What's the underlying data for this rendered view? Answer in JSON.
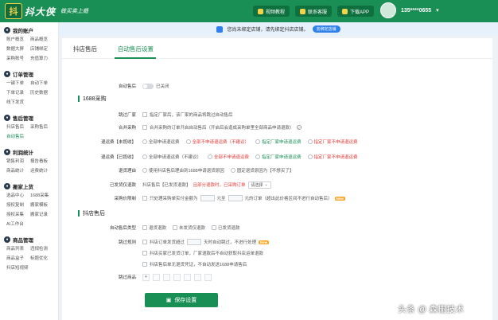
{
  "app": {
    "logo_badge": "抖",
    "logo_name": "抖大侠",
    "slogan": "做买卖上瘾"
  },
  "header": {
    "buttons": [
      {
        "label": "视频教程",
        "icon": "play-icon"
      },
      {
        "label": "联系客服",
        "icon": "chat-icon"
      },
      {
        "label": "下载APP",
        "icon": "download-icon"
      }
    ],
    "user_phone": "135****0655",
    "user_chevron": "▾"
  },
  "sidebar": [
    {
      "title": "我的账户",
      "icon": "user-icon",
      "items": [
        "账户概览",
        "商品概览",
        "数据大屏",
        "店铺绑定",
        "采购账号",
        "充值算力"
      ]
    },
    {
      "title": "订单管理",
      "icon": "order-icon",
      "items": [
        "一键下单",
        "自动下单",
        "下单记录",
        "历史数据",
        "线下发货"
      ]
    },
    {
      "title": "售后管理",
      "icon": "aftersale-icon",
      "items": [
        "抖店售后",
        "采购售后",
        "自动售后"
      ],
      "active": "自动售后"
    },
    {
      "title": "利润统计",
      "icon": "profit-icon",
      "items": [
        "销售利润",
        "报告看板",
        "商品统计",
        "运费统计"
      ]
    },
    {
      "title": "搬家上货",
      "icon": "move-icon",
      "items": [
        "选品中心",
        "1688采集",
        "授权复制",
        "搬家模板",
        "授权采集",
        "搬家记录",
        "AI工作台"
      ]
    },
    {
      "title": "商品管理",
      "icon": "goods-icon",
      "items": [
        "商品列表",
        "违规检测",
        "商品盒子",
        "标题优化",
        "抖店短视频"
      ]
    }
  ],
  "notice": {
    "text": "您尚未绑定店铺，请先绑定抖店店铺。",
    "button": "去绑定店铺"
  },
  "tabs": [
    "抖店售后",
    "自动售后设置"
  ],
  "active_tab": "自动售后设置",
  "form": {
    "auto_aftersale": {
      "label": "自动售后",
      "value": "已关闭"
    },
    "section_1688": "1688采购",
    "skip_vendor": {
      "label": "跳过厂家",
      "text": "指定厂家后，该厂家的商品将跳过自动售后"
    },
    "merge": {
      "label": "合并采购",
      "text": "合并采购的订单开启自动售后（开启后会造成采购单里全部商品申请退款）"
    },
    "refund_unshipped": {
      "label": "退运费【未揽收】",
      "options": [
        "全部申请退运费",
        "全部不申请退运费（不建议）",
        "指定厂家申请退运费",
        "指定厂家不申请退运费"
      ]
    },
    "refund_shipped": {
      "label": "退运费【已揽收】",
      "options": [
        "全部申请退运费（不建议）",
        "全部不申请退运费",
        "指定厂家申请退运费",
        "指定厂家不申请退运费"
      ]
    },
    "refund_reason": {
      "label": "退货理由",
      "options": [
        "使用抖店售后理由到1688申请退货原因",
        "固定退货原因为【不想买了】"
      ]
    },
    "shipped_sync": {
      "label": "已发货仅退款",
      "prefix": "抖店售后【已发货退款】",
      "mid": "且部分退款时，已采购订单",
      "select": "请选择"
    },
    "purchase_limit": {
      "label": "采购价限制",
      "p1": "只处理采购单实付金额为",
      "p2": "元至",
      "p3": "元的订单（超出此价格区间不进行自动售后）",
      "tag": "New"
    },
    "section_store": "抖店售后",
    "aftersale_type": {
      "label": "自动售后类型",
      "options": [
        "退货退款",
        "未发货仅退款",
        "已发货退款"
      ]
    },
    "skip_rule": {
      "label": "跳过规则",
      "lines": [
        "抖店订单发货超过",
        "天时自动跳过，不进行处理",
        "抖店买家已发货订单，厂家退款后不自动获取抖店运单退款",
        "抖店售后单无退货凭证，不自动发送1688申请售后"
      ],
      "tag": "New"
    },
    "skip_goods": {
      "label": "跳过商品"
    },
    "save": "保存设置"
  },
  "watermark": "头条 @ 森榭技术"
}
